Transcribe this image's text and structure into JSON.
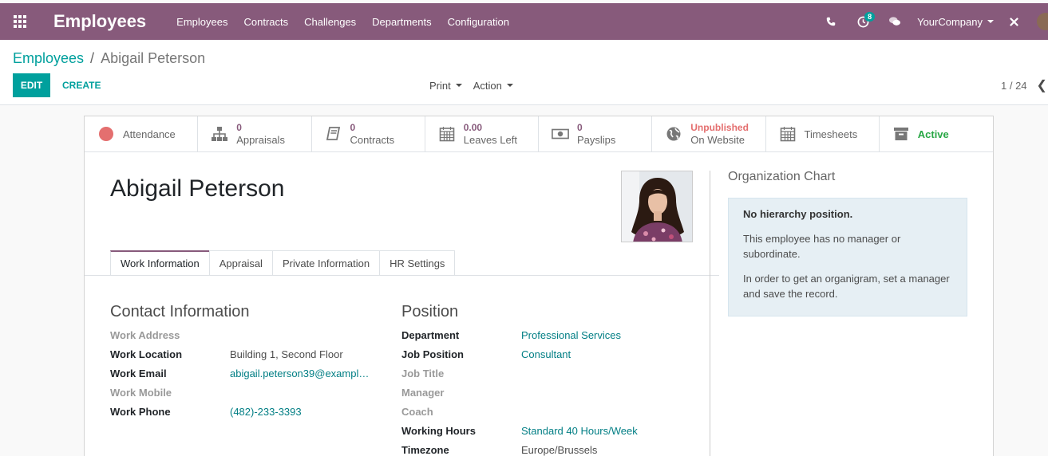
{
  "navbar": {
    "brand": "Employees",
    "menu": [
      "Employees",
      "Contracts",
      "Challenges",
      "Departments",
      "Configuration"
    ],
    "activity_count": "8",
    "company": "YourCompany",
    "colors": {
      "navbar": "#875a7b",
      "accent": "#00a09d"
    }
  },
  "breadcrumb": {
    "parent": "Employees",
    "separator": "/",
    "current": "Abigail Peterson"
  },
  "toolbar": {
    "edit": "EDIT",
    "create": "CREATE",
    "print": "Print",
    "action": "Action",
    "pager": "1 / 24"
  },
  "stat_buttons": [
    {
      "icon": "attendance-dot-icon",
      "label": "Attendance"
    },
    {
      "icon": "sitemap-icon",
      "value": "0",
      "label": "Appraisals"
    },
    {
      "icon": "book-icon",
      "value": "0",
      "label": "Contracts"
    },
    {
      "icon": "calendar-icon",
      "value": "0.00",
      "label": "Leaves Left"
    },
    {
      "icon": "money-icon",
      "value": "0",
      "label": "Payslips"
    },
    {
      "icon": "globe-icon",
      "value": "Unpublished",
      "label": "On Website"
    },
    {
      "icon": "calendar-icon",
      "label": "Timesheets"
    },
    {
      "icon": "archive-icon",
      "label": "Active"
    }
  ],
  "employee": {
    "name": "Abigail Peterson"
  },
  "tabs": [
    "Work Information",
    "Appraisal",
    "Private Information",
    "HR Settings"
  ],
  "contact": {
    "title": "Contact Information",
    "fields": [
      {
        "label": "Work Address",
        "value": ""
      },
      {
        "label": "Work Location",
        "value": "Building 1, Second Floor"
      },
      {
        "label": "Work Email",
        "value": "abigail.peterson39@exampl…"
      },
      {
        "label": "Work Mobile",
        "value": ""
      },
      {
        "label": "Work Phone",
        "value": "(482)-233-3393"
      }
    ]
  },
  "position": {
    "title": "Position",
    "fields": [
      {
        "label": "Department",
        "value": "Professional Services"
      },
      {
        "label": "Job Position",
        "value": "Consultant"
      },
      {
        "label": "Job Title",
        "value": ""
      },
      {
        "label": "Manager",
        "value": ""
      },
      {
        "label": "Coach",
        "value": ""
      },
      {
        "label": "Working Hours",
        "value": "Standard 40 Hours/Week"
      },
      {
        "label": "Timezone",
        "value": "Europe/Brussels"
      }
    ]
  },
  "org_chart": {
    "title": "Organization Chart",
    "heading": "No hierarchy position.",
    "line1": "This employee has no manager or subordinate.",
    "line2": "In order to get an organigram, set a manager and save the record."
  }
}
